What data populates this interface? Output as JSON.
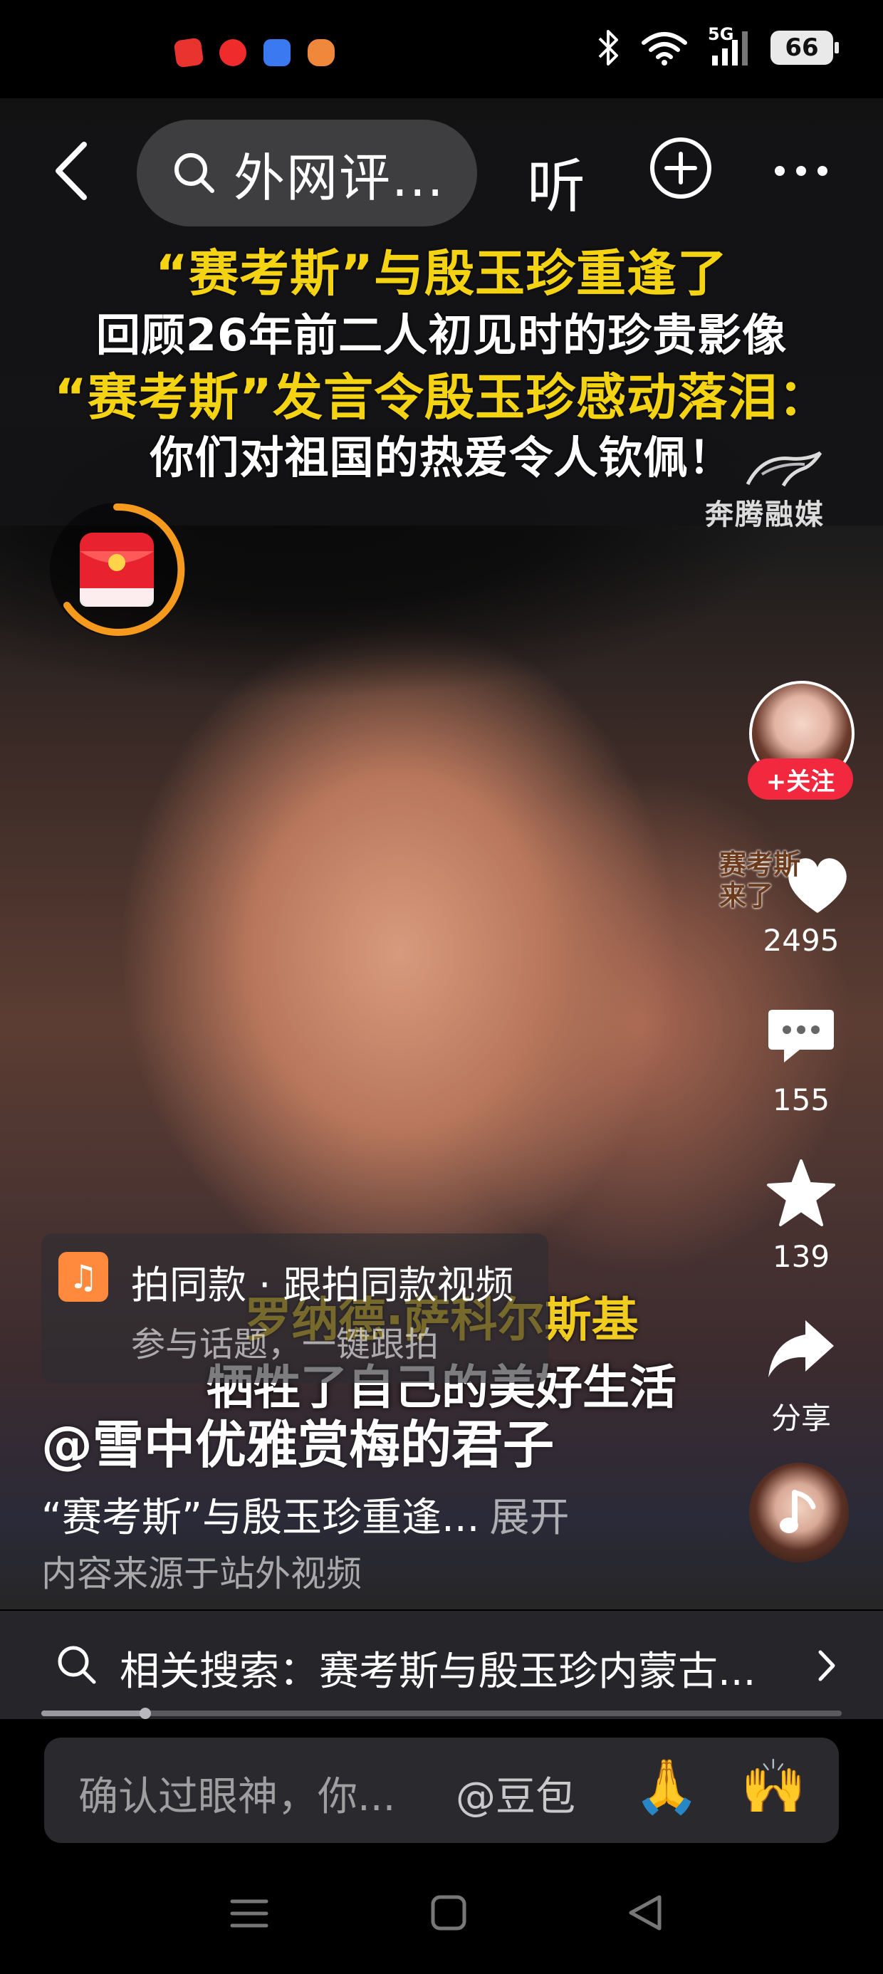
{
  "status_bar": {
    "signal_label": "5G",
    "battery": "66",
    "app_icon_colors": [
      "#e8332f",
      "#f02b2b",
      "#3b79f0",
      "#f0883b"
    ]
  },
  "top_nav": {
    "search_text": "外网评...",
    "listen_label": "听"
  },
  "video": {
    "caption_lines": [
      "“赛考斯”与殷玉珍重逢了",
      "回顾26年前二人初见时的珍贵影像",
      "“赛考斯”发言令殷玉珍感动落泪：",
      "你们对祖国的热爱令人钦佩！"
    ],
    "watermark": "奔腾融媒",
    "subtitle_top": "罗纳德·萨科尔斯基",
    "subtitle_bottom": "牺牲了自己的美好生活"
  },
  "right_rail": {
    "follow_label": "+关注",
    "like_sticker": "赛考斯来了",
    "like_count": "2495",
    "comment_count": "155",
    "star_count": "139",
    "share_label": "分享"
  },
  "same_style": {
    "title": "拍同款 · 跟拍同款视频",
    "subtitle": "参与话题，一键跟拍"
  },
  "post": {
    "author": "@雪中优雅赏梅的君子",
    "description": "“赛考斯”与殷玉珍重逢...",
    "expand_label": "展开",
    "source_note": "内容来源于站外视频"
  },
  "related_search": {
    "text": "相关搜索：赛考斯与殷玉珍内蒙古..."
  },
  "playback": {
    "progress": 0.13
  },
  "comment_input": {
    "placeholder": "确认过眼神，你...",
    "mention": "@豆包",
    "emoji_1": "🙏",
    "emoji_2": "🙌"
  },
  "colors": {
    "accent_red": "#f2283e",
    "caption_yellow": "#f4d312",
    "timer_orange": "#f59a1c"
  }
}
